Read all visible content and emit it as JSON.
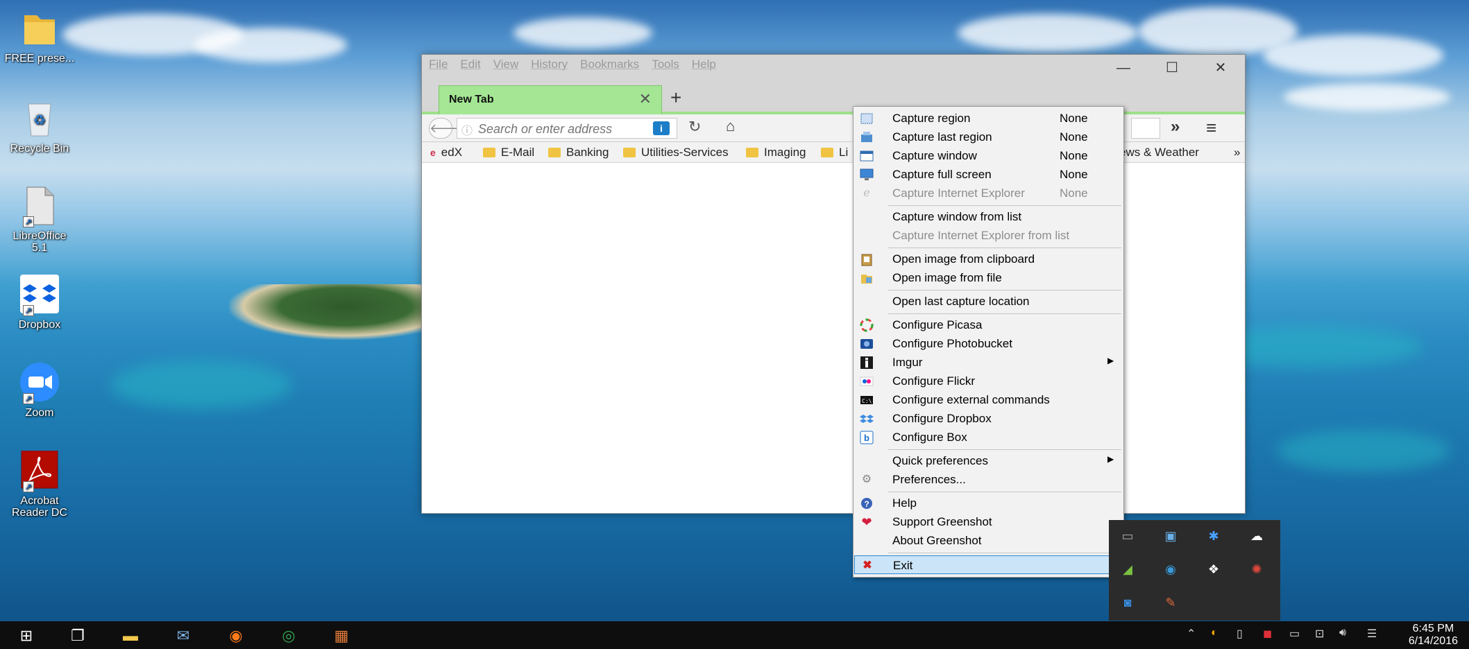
{
  "desktop": {
    "icons": [
      {
        "label": "FREE prese...",
        "icon": "folder-icon"
      },
      {
        "label": "Recycle Bin",
        "icon": "recycle-bin-icon"
      },
      {
        "label": "LibreOffice 5.1",
        "icon": "libreoffice-icon"
      },
      {
        "label": "Dropbox",
        "icon": "dropbox-icon"
      },
      {
        "label": "Zoom",
        "icon": "zoom-icon"
      },
      {
        "label": "Acrobat Reader DC",
        "icon": "acrobat-icon"
      }
    ]
  },
  "firefox": {
    "menu": [
      "File",
      "Edit",
      "View",
      "History",
      "Bookmarks",
      "Tools",
      "Help"
    ],
    "window_controls": {
      "minimize": "—",
      "maximize": "☐",
      "close": "✕"
    },
    "tab_title": "New Tab",
    "tab_close": "✕",
    "new_tab": "+",
    "url_placeholder": "Search or enter address",
    "bookmarks": [
      "edX",
      "E-Mail",
      "Banking",
      "Utilities-Services",
      "Imaging",
      "Li",
      "ews & Weather"
    ],
    "bookmarks_overflow": "»",
    "toolbar_overflow": "»"
  },
  "context_menu": {
    "items": [
      {
        "label": "Capture region",
        "shortcut": "None",
        "icon": "region-icon"
      },
      {
        "label": "Capture last region",
        "shortcut": "None",
        "icon": "last-region-icon"
      },
      {
        "label": "Capture window",
        "shortcut": "None",
        "icon": "window-icon"
      },
      {
        "label": "Capture full screen",
        "shortcut": "None",
        "icon": "fullscreen-icon"
      },
      {
        "label": "Capture Internet Explorer",
        "shortcut": "None",
        "icon": "ie-icon",
        "disabled": true
      },
      {
        "label": "Capture window from list",
        "icon": ""
      },
      {
        "label": "Capture Internet Explorer from list",
        "icon": "",
        "disabled": true
      },
      {
        "label": "Open image from clipboard",
        "icon": "clipboard-icon"
      },
      {
        "label": "Open image from file",
        "icon": "file-icon"
      },
      {
        "label": "Open last capture location",
        "icon": ""
      },
      {
        "label": "Configure Picasa",
        "icon": "picasa-icon"
      },
      {
        "label": "Configure Photobucket",
        "icon": "photobucket-icon"
      },
      {
        "label": "Imgur",
        "icon": "imgur-icon",
        "submenu": true
      },
      {
        "label": "Configure Flickr",
        "icon": "flickr-icon"
      },
      {
        "label": "Configure external commands",
        "icon": "command-icon"
      },
      {
        "label": "Configure Dropbox",
        "icon": "dropbox-icon"
      },
      {
        "label": "Configure Box",
        "icon": "box-icon"
      },
      {
        "label": "Quick preferences",
        "icon": "",
        "submenu": true
      },
      {
        "label": "Preferences...",
        "icon": "gear-icon"
      },
      {
        "label": "Help",
        "icon": "help-icon"
      },
      {
        "label": "Support Greenshot",
        "icon": "heart-icon"
      },
      {
        "label": "About Greenshot",
        "icon": ""
      },
      {
        "label": "Exit",
        "icon": "exit-icon",
        "highlighted": true
      }
    ]
  },
  "taskbar": {
    "time": "6:45 PM",
    "date": "6/14/2016"
  },
  "colors": {
    "tab_active": "#a4e694",
    "menu_highlight": "#cce4f7",
    "taskbar": "#0e0e0e"
  }
}
